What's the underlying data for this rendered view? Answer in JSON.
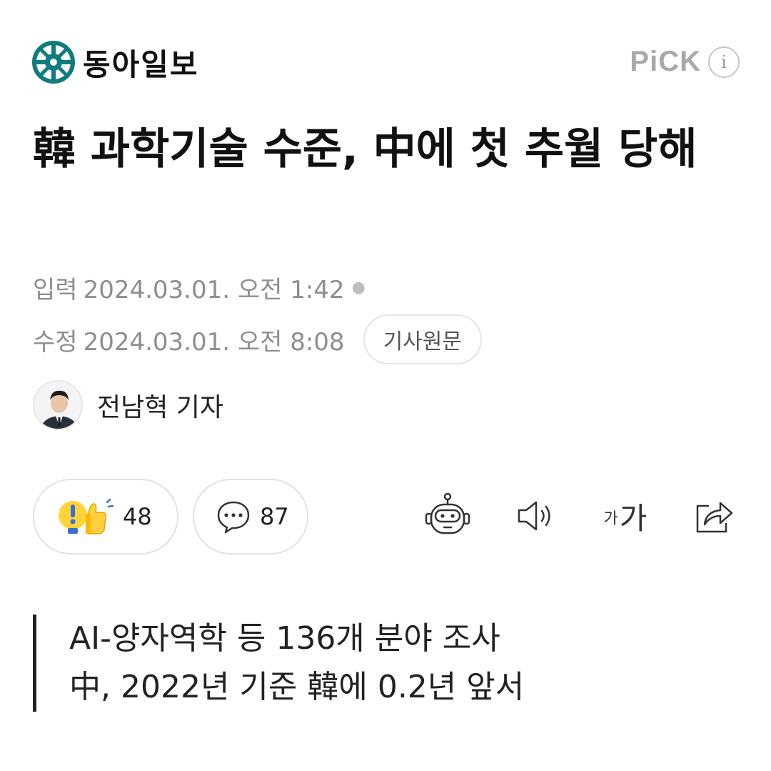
{
  "header": {
    "logo_icon": "donga-globe-icon",
    "logo_text": "동아일보",
    "pick_label": "PiCK",
    "info_icon": "info-icon",
    "info_glyph": "i"
  },
  "article": {
    "title": "韓 과학기술 수준, 中에 첫 추월 당해",
    "input_label": "입력",
    "input_time": "2024.03.01. 오전 1:42",
    "edit_label": "수정",
    "edit_time": "2024.03.01. 오전 8:08",
    "origin_button": "기사원문",
    "reporter": "전남혁 기자"
  },
  "actions": {
    "reaction_icon": "reaction-icon",
    "reaction_count": "48",
    "comment_icon": "comment-icon",
    "comment_count": "87",
    "tools": [
      "robot-summary-icon",
      "speaker-icon",
      "font-size-icon",
      "share-icon"
    ],
    "font_small": "가",
    "font_big": "가"
  },
  "summary": {
    "lines": [
      "AI-양자역학 등 136개 분야 조사",
      "中, 2022년 기준 韓에 0.2년 앞서"
    ]
  },
  "colors": {
    "brand": "#0f7c7e",
    "muted": "#8e8e8e",
    "border": "#e2e2e2"
  }
}
